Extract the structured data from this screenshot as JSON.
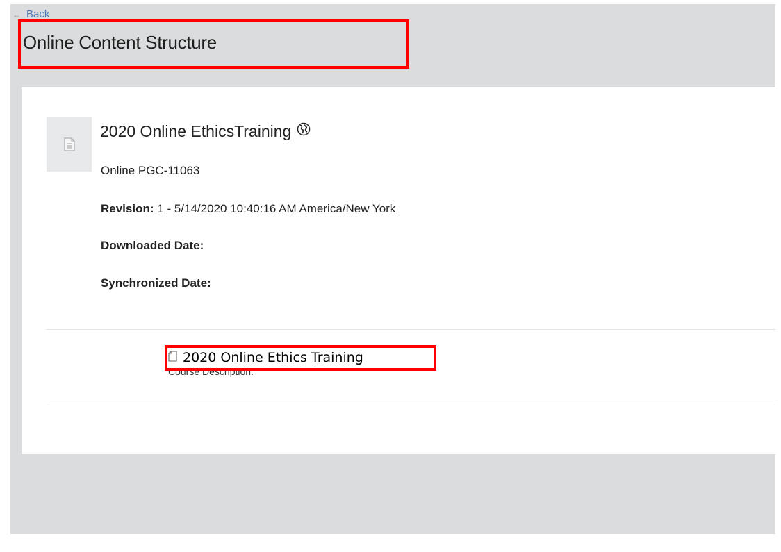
{
  "header": {
    "back_label": "Back",
    "page_title": "Online Content Structure"
  },
  "course": {
    "title": "2020 Online EthicsTraining",
    "code": "Online PGC-11063",
    "revision_label": "Revision:",
    "revision_value": "1 - 5/14/2020 10:40:16 AM America/New York",
    "downloaded_label": "Downloaded Date:",
    "downloaded_value": "",
    "synchronized_label": "Synchronized Date:",
    "synchronized_value": ""
  },
  "structure": {
    "items": [
      {
        "title": "2020 Online Ethics Training",
        "description": "Course Description."
      }
    ]
  },
  "icons": {
    "thumbnail": "document-icon",
    "course_badge": "globe-icon",
    "item": "page-icon"
  },
  "colors": {
    "page_background": "#dadcdd",
    "card_background": "#ffffff",
    "link": "#4d79b5",
    "highlight": "#ff0000"
  }
}
